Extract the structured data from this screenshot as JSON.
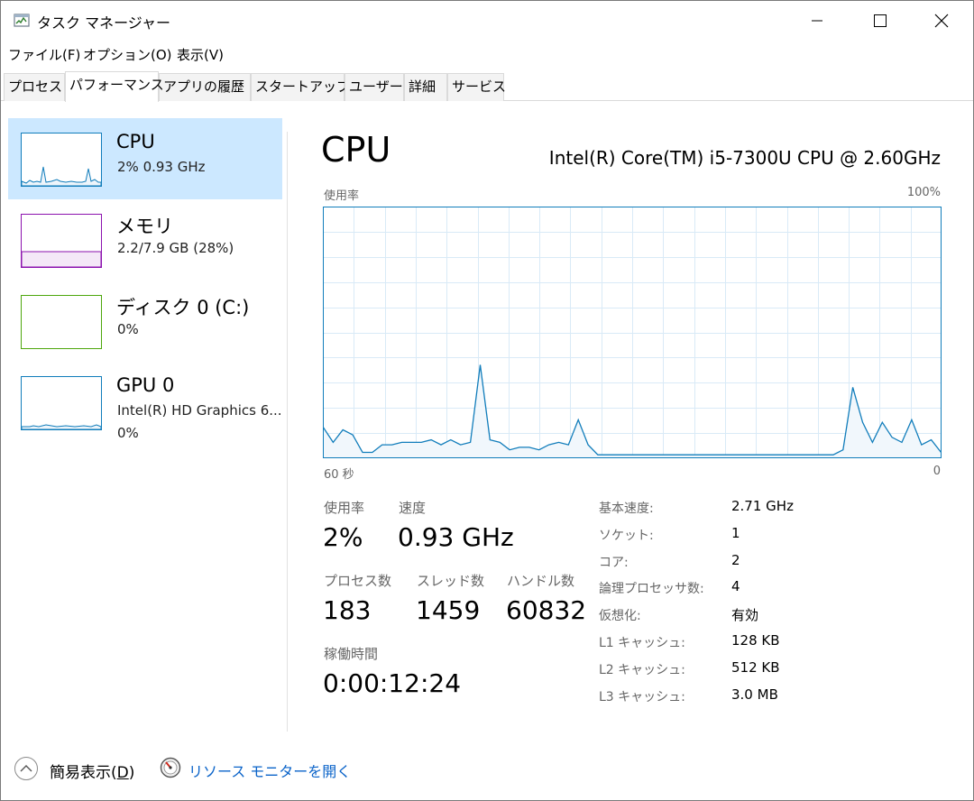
{
  "window": {
    "title": "タスク マネージャー"
  },
  "menu": [
    "ファイル(F)",
    "オプション(O)",
    "表示(V)"
  ],
  "tabs": [
    {
      "label": "プロセス",
      "active": false
    },
    {
      "label": "パフォーマンス",
      "active": true
    },
    {
      "label": "アプリの履歴",
      "active": false
    },
    {
      "label": "スタートアップ",
      "active": false
    },
    {
      "label": "ユーザー",
      "active": false
    },
    {
      "label": "詳細",
      "active": false
    },
    {
      "label": "サービス",
      "active": false
    }
  ],
  "sidebar": {
    "items": [
      {
        "name": "CPU",
        "line1": "2%  0.93 GHz",
        "line2": "",
        "color": "#117dbb",
        "selected": true
      },
      {
        "name": "メモリ",
        "line1": "2.2/7.9 GB (28%)",
        "line2": "",
        "color": "#8b12ae",
        "selected": false
      },
      {
        "name": "ディスク 0 (C:)",
        "line1": "0%",
        "line2": "",
        "color": "#4da60c",
        "selected": false
      },
      {
        "name": "GPU 0",
        "line1": "Intel(R) HD Graphics 6...",
        "line2": "0%",
        "color": "#117dbb",
        "selected": false
      }
    ]
  },
  "main": {
    "title": "CPU",
    "model": "Intel(R) Core(TM) i5-7300U CPU @ 2.60GHz",
    "graph": {
      "top_left_label": "使用率",
      "top_right_label": "100%",
      "bottom_left_label": "60 秒",
      "bottom_right_label": "0",
      "line_color": "#117dbb",
      "grid_color": "#d9eaf7"
    },
    "stats": {
      "usage_label": "使用率",
      "usage_value": "2%",
      "speed_label": "速度",
      "speed_value": "0.93 GHz",
      "processes_label": "プロセス数",
      "processes_value": "183",
      "threads_label": "スレッド数",
      "threads_value": "1459",
      "handles_label": "ハンドル数",
      "handles_value": "60832",
      "uptime_label": "稼働時間",
      "uptime_value": "0:00:12:24"
    },
    "details": [
      {
        "label": "基本速度:",
        "value": "2.71 GHz"
      },
      {
        "label": "ソケット:",
        "value": "1"
      },
      {
        "label": "コア:",
        "value": "2"
      },
      {
        "label": "論理プロセッサ数:",
        "value": "4"
      },
      {
        "label": "仮想化:",
        "value": "有効"
      },
      {
        "label": "L1 キャッシュ:",
        "value": "128 KB"
      },
      {
        "label": "L2 キャッシュ:",
        "value": "512 KB"
      },
      {
        "label": "L3 キャッシュ:",
        "value": "3.0 MB"
      }
    ]
  },
  "footer": {
    "fewer_details_prefix": "簡易表示(",
    "fewer_details_key": "D",
    "fewer_details_suffix": ")",
    "resource_monitor_link": "リソース モニターを開く"
  },
  "chart_data": {
    "type": "area",
    "x_range_seconds": [
      60,
      0
    ],
    "ylim": [
      0,
      100
    ],
    "grid": true,
    "values": [
      12,
      6,
      11,
      9,
      2,
      2,
      5,
      5,
      6,
      6,
      6,
      7,
      5,
      7,
      5,
      6,
      37,
      7,
      6,
      3,
      4,
      4,
      3,
      5,
      6,
      5,
      15,
      5,
      1,
      1,
      1,
      1,
      1,
      1,
      1,
      1,
      1,
      1,
      1,
      1,
      1,
      1,
      1,
      1,
      1,
      1,
      1,
      1,
      1,
      1,
      1,
      1,
      1,
      3,
      28,
      14,
      6,
      14,
      8,
      6,
      15,
      5,
      7,
      2
    ]
  }
}
